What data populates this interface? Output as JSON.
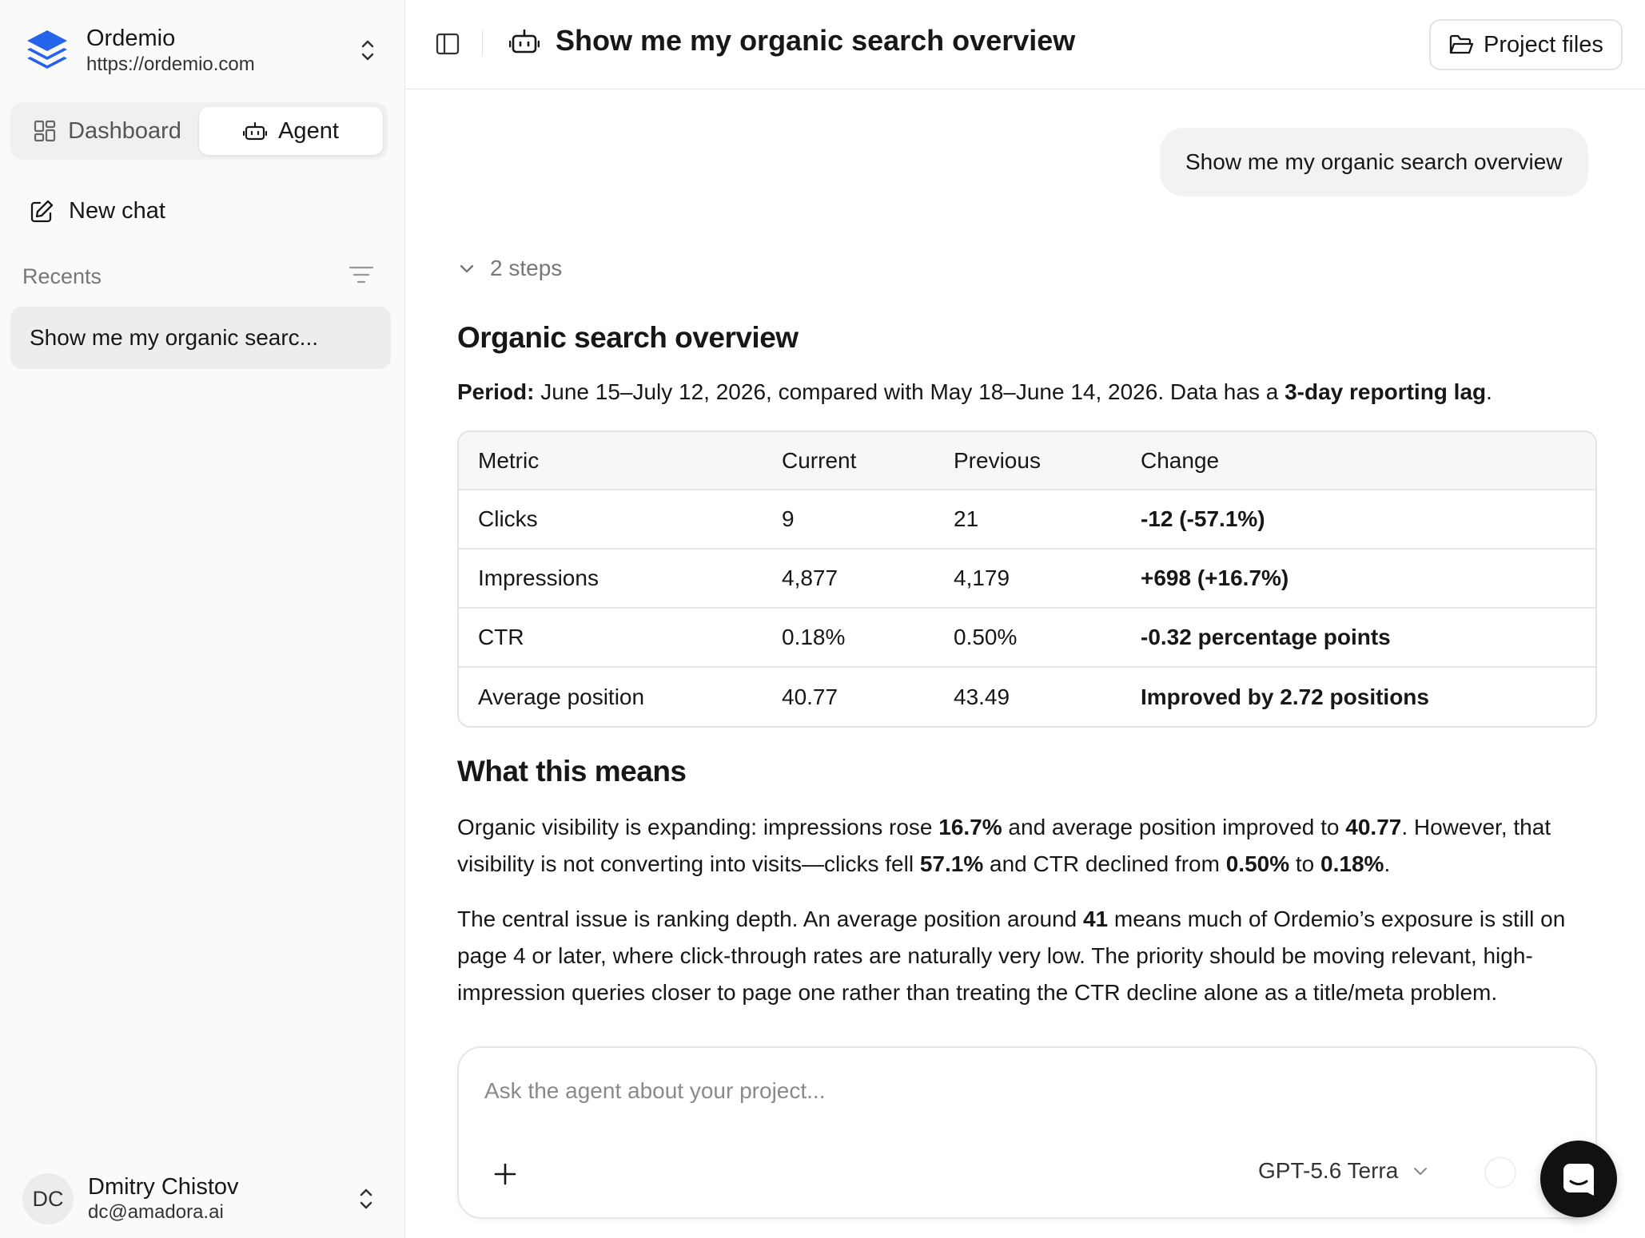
{
  "sidebar": {
    "project": {
      "name": "Ordemio",
      "url": "https://ordemio.com"
    },
    "tabs": [
      {
        "label": "Dashboard",
        "icon": "dashboard-icon",
        "active": false
      },
      {
        "label": "Agent",
        "icon": "bot-icon",
        "active": true
      }
    ],
    "new_chat_label": "New chat",
    "recents_label": "Recents",
    "recent_items": [
      {
        "label": "Show me my organic searc..."
      }
    ],
    "user": {
      "initials": "DC",
      "name": "Dmitry Chistov",
      "email": "dc@amadora.ai"
    }
  },
  "header": {
    "title": "Show me my organic search overview",
    "project_files_label": "Project files"
  },
  "conversation": {
    "user_message": "Show me my organic search overview",
    "steps_label": "2 steps",
    "overview_heading": "Organic search overview",
    "period": {
      "label": "Period:",
      "text": " June 15–July 12, 2026, compared with May 18–June 14, 2026. Data has a ",
      "lag": "3-day reporting lag",
      "end": "."
    },
    "table": {
      "headers": [
        "Metric",
        "Current",
        "Previous",
        "Change"
      ],
      "rows": [
        [
          "Clicks",
          "9",
          "21",
          "-12 (-57.1%)"
        ],
        [
          "Impressions",
          "4,877",
          "4,179",
          "+698 (+16.7%)"
        ],
        [
          "CTR",
          "0.18%",
          "0.50%",
          "-0.32 percentage points"
        ],
        [
          "Average position",
          "40.77",
          "43.49",
          "Improved by 2.72 positions"
        ]
      ]
    },
    "means_heading": "What this means",
    "p1": {
      "t1": "Organic visibility is expanding: impressions rose ",
      "b1": "16.7%",
      "t2": " and average position improved to ",
      "b2": "40.77",
      "t3": ". However, that visibility is not converting into visits—clicks fell ",
      "b3": "57.1%",
      "t4": " and CTR declined from ",
      "b4": "0.50%",
      "t5": " to ",
      "b5": "0.18%",
      "t6": "."
    },
    "p2": {
      "t1": "The central issue is ranking depth. An average position around ",
      "b1": "41",
      "t2": " means much of Ordemio’s exposure is still on page 4 or later, where click-through rates are naturally very low. The priority should be moving relevant, high-impression queries closer to page one rather than treating the CTR decline alone as a title/meta problem."
    }
  },
  "composer": {
    "placeholder": "Ask the agent about your project...",
    "value": "",
    "model": "GPT-5.6 Terra"
  },
  "colors": {
    "accent": "#2563eb",
    "fab": "#111111",
    "sidebar_bg": "#fafafa"
  }
}
